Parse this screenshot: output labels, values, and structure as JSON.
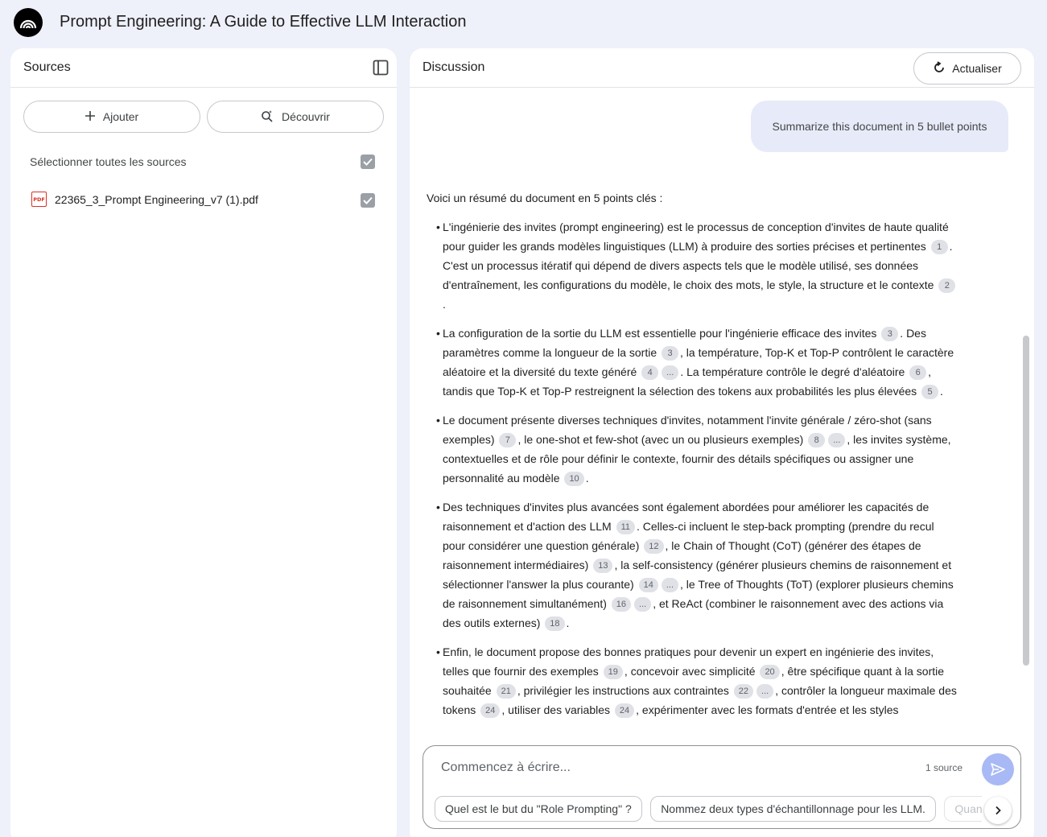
{
  "app": {
    "title": "Prompt Engineering: A Guide to Effective LLM Interaction"
  },
  "sources": {
    "title": "Sources",
    "add_label": "Ajouter",
    "discover_label": "Découvrir",
    "select_all_label": "Sélectionner toutes les sources",
    "items": [
      {
        "name": "22365_3_Prompt Engineering_v7 (1).pdf",
        "type_badge": "PDF",
        "checked": true
      }
    ]
  },
  "chat": {
    "title": "Discussion",
    "refresh_label": "Actualiser",
    "user_message": "Summarize this document in 5 bullet points",
    "answer_intro": "Voici un résumé du document en 5 points clés :",
    "answer_bullets": [
      [
        {
          "t": "L'ingénierie des invites (prompt engineering) est le processus de conception d'invites de haute qualité pour guider les grands modèles linguistiques (LLM) à produire des sorties précises et pertinentes "
        },
        {
          "c": "1"
        },
        {
          "t": ". C'est un processus itératif qui dépend de divers aspects tels que le modèle utilisé, ses données d'entraînement, les configurations du modèle, le choix des mots, le style, la structure et le contexte "
        },
        {
          "c": "2"
        },
        {
          "t": "."
        }
      ],
      [
        {
          "t": "La configuration de la sortie du LLM est essentielle pour l'ingénierie efficace des invites "
        },
        {
          "c": "3"
        },
        {
          "t": ". Des paramètres comme la longueur de la sortie "
        },
        {
          "c": "3"
        },
        {
          "t": ", la température, Top-K et Top-P contrôlent le caractère aléatoire et la diversité du texte généré "
        },
        {
          "c": "4"
        },
        {
          "c": "..."
        },
        {
          "t": ". La température contrôle le degré d'aléatoire "
        },
        {
          "c": "6"
        },
        {
          "t": ", tandis que Top-K et Top-P restreignent la sélection des tokens aux probabilités les plus élevées "
        },
        {
          "c": "5"
        },
        {
          "t": "."
        }
      ],
      [
        {
          "t": "Le document présente diverses techniques d'invites, notamment l'invite générale / zéro-shot (sans exemples) "
        },
        {
          "c": "7"
        },
        {
          "t": ", le one-shot et few-shot (avec un ou plusieurs exemples) "
        },
        {
          "c": "8"
        },
        {
          "c": "..."
        },
        {
          "t": ", les invites système, contextuelles et de rôle pour définir le contexte, fournir des détails spécifiques ou assigner une personnalité au modèle "
        },
        {
          "c": "10"
        },
        {
          "t": "."
        }
      ],
      [
        {
          "t": "Des techniques d'invites plus avancées sont également abordées pour améliorer les capacités de raisonnement et d'action des LLM "
        },
        {
          "c": "11"
        },
        {
          "t": ". Celles-ci incluent le step-back prompting (prendre du recul pour considérer une question générale) "
        },
        {
          "c": "12"
        },
        {
          "t": ", le Chain of Thought (CoT) (générer des étapes de raisonnement intermédiaires) "
        },
        {
          "c": "13"
        },
        {
          "t": ", la self-consistency (générer plusieurs chemins de raisonnement et sélectionner l'answer la plus courante) "
        },
        {
          "c": "14"
        },
        {
          "c": "..."
        },
        {
          "t": ", le Tree of Thoughts (ToT) (explorer plusieurs chemins de raisonnement simultanément) "
        },
        {
          "c": "16"
        },
        {
          "c": "..."
        },
        {
          "t": ", et ReAct (combiner le raisonnement avec des actions via des outils externes) "
        },
        {
          "c": "18"
        },
        {
          "t": "."
        }
      ],
      [
        {
          "t": "Enfin, le document propose des bonnes pratiques pour devenir un expert en ingénierie des invites, telles que fournir des exemples "
        },
        {
          "c": "19"
        },
        {
          "t": ", concevoir avec simplicité "
        },
        {
          "c": "20"
        },
        {
          "t": ", être spécifique quant à la sortie souhaitée "
        },
        {
          "c": "21"
        },
        {
          "t": ", privilégier les instructions aux contraintes "
        },
        {
          "c": "22"
        },
        {
          "c": "..."
        },
        {
          "t": ", contrôler la longueur maximale des tokens "
        },
        {
          "c": "24"
        },
        {
          "t": ", utiliser des variables "
        },
        {
          "c": "24"
        },
        {
          "t": ", expérimenter avec les formats d'entrée et les styles"
        }
      ]
    ],
    "composer": {
      "placeholder": "Commencez à écrire...",
      "source_count": "1 source",
      "suggestions": [
        "Quel est le but du \"Role Prompting\" ?",
        "Nommez deux types d'échantillonnage pour les LLM.",
        "Quan"
      ]
    }
  }
}
